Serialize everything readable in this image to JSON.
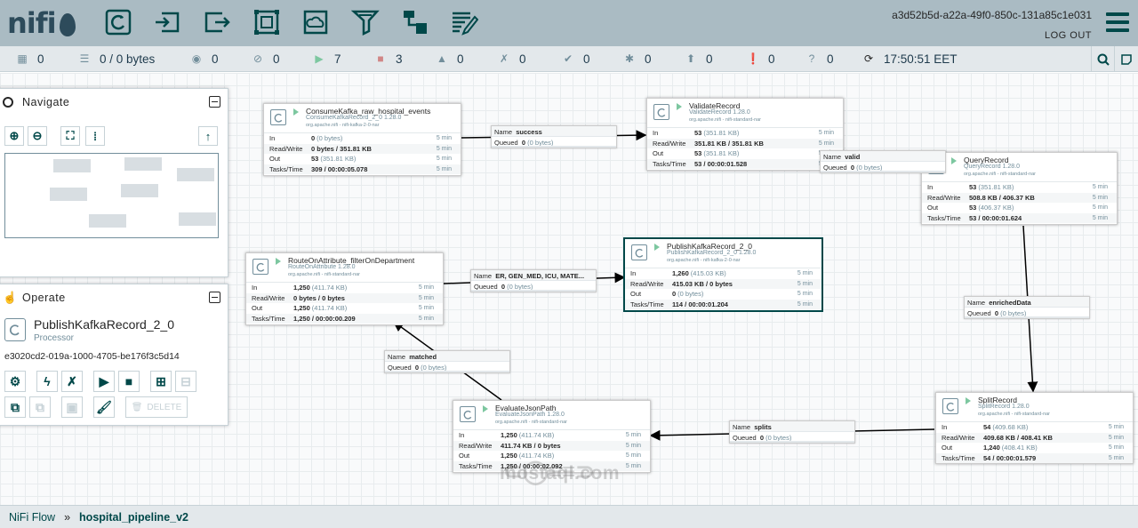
{
  "header": {
    "logo_text": "nifi",
    "user": "a3d52b5d-a22a-49f0-850c-131a85c1e031",
    "logout": "LOG OUT",
    "toolbar_icons": [
      "processor-icon",
      "input-port-icon",
      "output-port-icon",
      "process-group-icon",
      "remote-process-group-icon",
      "funnel-icon",
      "template-icon",
      "label-icon"
    ]
  },
  "status": {
    "active_threads": "0",
    "queued": "0 / 0 bytes",
    "transmitting": "0",
    "not_transmitting": "0",
    "running": "7",
    "stopped": "3",
    "invalid": "0",
    "disabled": "0",
    "up_to_date": "0",
    "locally_modified": "0",
    "stale": "0",
    "locally_modified_stale": "0",
    "sync_failure": "0",
    "refresh_time": "17:50:51 EET"
  },
  "navigate": {
    "title": "Navigate"
  },
  "operate": {
    "title": "Operate",
    "selected_name": "PublishKafkaRecord_2_0",
    "selected_type": "Processor",
    "selected_id": "e3020cd2-019a-1000-4705-be176f3c5d14",
    "delete_label": "DELETE"
  },
  "processors": [
    {
      "name": "ConsumeKafka_raw_hospital_events",
      "type": "ConsumeKafkaRecord_2_0 1.28.0",
      "bundle": "org.apache.nifi - nifi-kafka-2-0-nar",
      "in": "0",
      "in_sub": "(0 bytes)",
      "rw": "0 bytes / 351.81 KB",
      "out": "53",
      "out_sub": "(351.81 KB)",
      "tasks": "309 / 00:00:05.078",
      "time": "5 min"
    },
    {
      "name": "ValidateRecord",
      "type": "ValidateRecord 1.28.0",
      "bundle": "org.apache.nifi - nifi-standard-nar",
      "in": "53",
      "in_sub": "(351.81 KB)",
      "rw": "351.81 KB / 351.81 KB",
      "out": "53",
      "out_sub": "(351.81 KB)",
      "tasks": "53 / 00:00:01.528",
      "time": "5 min"
    },
    {
      "name": "QueryRecord",
      "type": "QueryRecord 1.28.0",
      "bundle": "org.apache.nifi - nifi-standard-nar",
      "in": "53",
      "in_sub": "(351.81 KB)",
      "rw": "508.8 KB / 406.37 KB",
      "out": "53",
      "out_sub": "(406.37 KB)",
      "tasks": "53 / 00:00:01.624",
      "time": "5 min"
    },
    {
      "name": "RouteOnAttribute_filterOnDepartment",
      "type": "RouteOnAttribute 1.28.0",
      "bundle": "org.apache.nifi - nifi-standard-nar",
      "in": "1,250",
      "in_sub": "(411.74 KB)",
      "rw": "0 bytes / 0 bytes",
      "out": "1,250",
      "out_sub": "(411.74 KB)",
      "tasks": "1,250 / 00:00:00.209",
      "time": "5 min"
    },
    {
      "name": "PublishKafkaRecord_2_0",
      "type": "PublishKafkaRecord_2_0 1.28.0",
      "bundle": "org.apache.nifi - nifi-kafka-2-0-nar",
      "in": "1,260",
      "in_sub": "(415.03 KB)",
      "rw": "415.03 KB / 0 bytes",
      "out": "0",
      "out_sub": "(0 bytes)",
      "tasks": "114 / 00:00:01.204",
      "time": "5 min"
    },
    {
      "name": "SplitRecord",
      "type": "SplitRecord 1.28.0",
      "bundle": "org.apache.nifi - nifi-standard-nar",
      "in": "54",
      "in_sub": "(409.68 KB)",
      "rw": "409.68 KB / 408.41 KB",
      "out": "1,240",
      "out_sub": "(408.41 KB)",
      "tasks": "54 / 00:00:01.579",
      "time": "5 min"
    },
    {
      "name": "EvaluateJsonPath",
      "type": "EvaluateJsonPath 1.28.0",
      "bundle": "org.apache.nifi - nifi-standard-nar",
      "in": "1,250",
      "in_sub": "(411.74 KB)",
      "rw": "411.74 KB / 0 bytes",
      "out": "1,250",
      "out_sub": "(411.74 KB)",
      "tasks": "1,250 / 00:00:02.092",
      "time": "5 min"
    }
  ],
  "row_labels": {
    "in": "In",
    "rw": "Read/Write",
    "out": "Out",
    "tasks": "Tasks/Time"
  },
  "connections": [
    {
      "name": "success",
      "queued": "0",
      "queued_sub": "(0 bytes)"
    },
    {
      "name": "valid",
      "queued": "0",
      "queued_sub": "(0 bytes)"
    },
    {
      "name": "enrichedData",
      "queued": "0",
      "queued_sub": "(0 bytes)"
    },
    {
      "name": "splits",
      "queued": "0",
      "queued_sub": "(0 bytes)"
    },
    {
      "name": "matched",
      "queued": "0",
      "queued_sub": "(0 bytes)"
    },
    {
      "name": "ER, GEN_MED, ICU, MATE...",
      "queued": "0",
      "queued_sub": "(0 bytes)"
    }
  ],
  "conn_labels": {
    "name": "Name",
    "queued": "Queued"
  },
  "breadcrumb": {
    "root": "NiFi Flow",
    "sep": "»",
    "current": "hospital_pipeline_v2"
  },
  "watermark": "mostaql.com",
  "colors": {
    "header": "#aabbc3",
    "accent": "#004849",
    "running": "#7dc7a0",
    "stopped": "#d18686",
    "canvas": "#f9fafb"
  }
}
